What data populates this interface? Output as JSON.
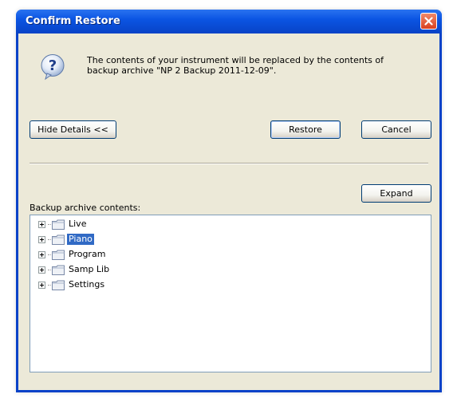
{
  "window": {
    "title": "Confirm Restore"
  },
  "message": {
    "line1": "The contents of your instrument will be replaced by the contents of",
    "line2": "backup archive \"NP 2 Backup 2011-12-09\"."
  },
  "buttons": {
    "hide_details": "Hide Details <<",
    "restore": "Restore",
    "cancel": "Cancel",
    "expand": "Expand"
  },
  "archive": {
    "label": "Backup archive contents:",
    "items": [
      {
        "label": "Live",
        "selected": false
      },
      {
        "label": "Piano",
        "selected": true
      },
      {
        "label": "Program",
        "selected": false
      },
      {
        "label": "Samp Lib",
        "selected": false
      },
      {
        "label": "Settings",
        "selected": false
      }
    ]
  },
  "colors": {
    "titlebar": "#0b55e3",
    "dialog_bg": "#ece9d8",
    "selection": "#316ac5",
    "close_button": "#d9401f"
  }
}
